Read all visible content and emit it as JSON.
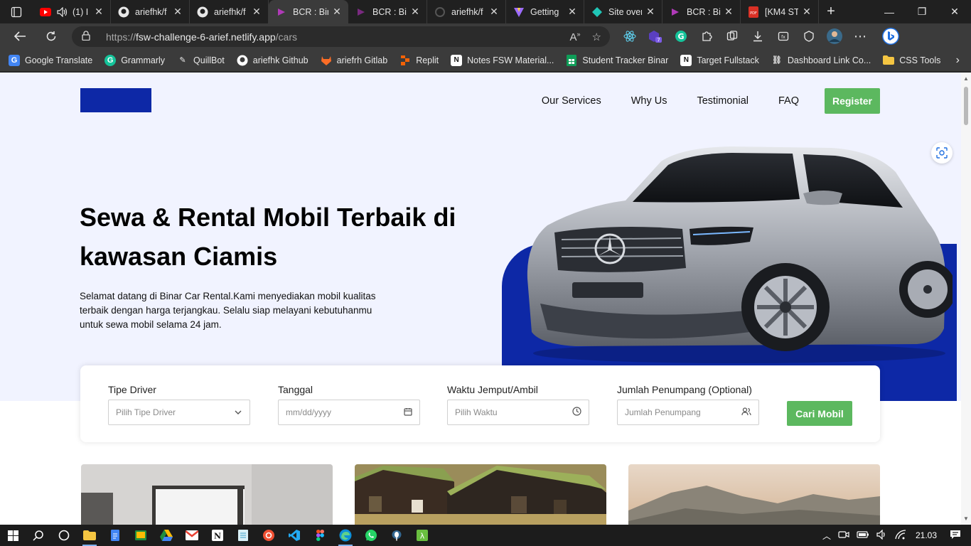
{
  "browser": {
    "tabs": [
      {
        "title": "(1) I",
        "icon": "youtube-icon",
        "audio": true
      },
      {
        "title": "ariefhk/f",
        "icon": "github-icon"
      },
      {
        "title": "ariefhk/f",
        "icon": "github-icon"
      },
      {
        "title": "BCR : Bir",
        "icon": "bcr-icon",
        "active": true
      },
      {
        "title": "BCR : Bir",
        "icon": "bcr-icon"
      },
      {
        "title": "ariefhk/f",
        "icon": "loading-icon"
      },
      {
        "title": "Getting",
        "icon": "vite-icon"
      },
      {
        "title": "Site over",
        "icon": "netlify-icon"
      },
      {
        "title": "BCR : Bir",
        "icon": "bcr-icon"
      },
      {
        "title": "[KM4 ST",
        "icon": "pdf-icon"
      }
    ],
    "url": {
      "scheme": "https://",
      "host": "fsw-challenge-6-arief.netlify.app",
      "path": "/cars"
    },
    "bookmarks": [
      {
        "label": "Google Translate",
        "icon": "google-translate-icon",
        "color": "#4285f4"
      },
      {
        "label": "Grammarly",
        "icon": "grammarly-icon",
        "color": "#15c39a"
      },
      {
        "label": "QuillBot",
        "icon": "quillbot-icon",
        "color": "#e8e8e8"
      },
      {
        "label": "ariefhk Github",
        "icon": "github-icon",
        "color": "#ffffff"
      },
      {
        "label": "ariefrh Gitlab",
        "icon": "gitlab-icon",
        "color": "#fc6d26"
      },
      {
        "label": "Replit",
        "icon": "replit-icon",
        "color": "#f26207"
      },
      {
        "label": "Notes FSW Material...",
        "icon": "notion-icon",
        "color": "#ffffff"
      },
      {
        "label": "Student Tracker Binar",
        "icon": "sheets-icon",
        "color": "#0f9d58"
      },
      {
        "label": "Target Fullstack",
        "icon": "notion-icon",
        "color": "#ffffff"
      },
      {
        "label": "Dashboard Link Co...",
        "icon": "link-icon",
        "color": "#cfcfcf"
      },
      {
        "label": "CSS Tools",
        "icon": "folder-icon",
        "color": "#f4c542"
      }
    ]
  },
  "page": {
    "nav": [
      {
        "label": "Our Services"
      },
      {
        "label": "Why Us"
      },
      {
        "label": "Testimonial"
      },
      {
        "label": "FAQ"
      }
    ],
    "register_label": "Register",
    "hero_title": "Sewa & Rental Mobil Terbaik di kawasan Ciamis",
    "hero_text": "Selamat datang di Binar Car Rental.Kami menyediakan mobil kualitas terbaik dengan harga terjangkau. Selalu siap melayani kebutuhanmu untuk sewa mobil selama 24 jam.",
    "search": {
      "fields": [
        {
          "label": "Tipe Driver",
          "placeholder": "Pilih Tipe Driver",
          "icon": "chevron-down-icon"
        },
        {
          "label": "Tanggal",
          "placeholder": "mm/dd/yyyy",
          "icon": "calendar-icon"
        },
        {
          "label": "Waktu Jemput/Ambil",
          "placeholder": "Pilih Waktu",
          "icon": "clock-icon"
        },
        {
          "label": "Jumlah Penumpang (Optional)",
          "placeholder": "Jumlah Penumpang",
          "icon": "users-icon"
        }
      ],
      "button_label": "Cari Mobil"
    },
    "colors": {
      "brand_blue": "#0d28a6",
      "accent_green": "#5cb85f",
      "hero_bg": "#f1f3ff"
    }
  },
  "taskbar": {
    "time": "21.03"
  }
}
